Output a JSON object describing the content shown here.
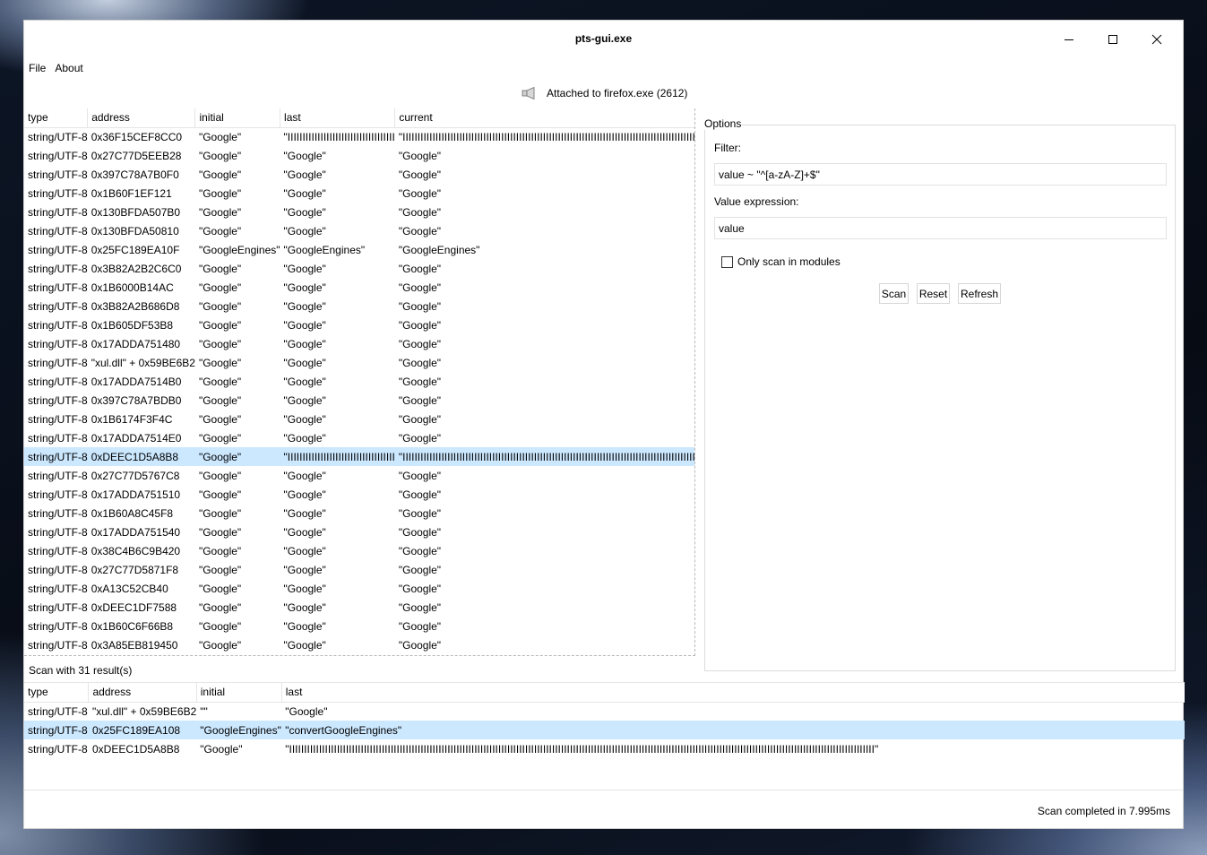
{
  "window": {
    "title": "pts-gui.exe",
    "minimize_icon": "minimize-icon",
    "maximize_icon": "maximize-icon",
    "close_icon": "close-icon"
  },
  "menu": {
    "file": "File",
    "about": "About"
  },
  "attached": {
    "icon": "speaker-icon",
    "text": "Attached to firefox.exe (2612)"
  },
  "results": {
    "columns": [
      "type",
      "address",
      "initial",
      "last",
      "current"
    ],
    "rows": [
      [
        "string/UTF-8",
        "0x36F15CEF8CC0",
        "\"Google\"",
        "\"IIIIIIIIIIIIIIIIIIIIIIIIIIIIIIIIIIII",
        "\"IIIIIIIIIIIIIIIIIIIIIIIIIIIIIIIIIIIIIIIIIIIIIIIIIIIIIIIIIIIIIIIIIIIIIIIIIIIIIIIIIIIIIIIIIIIIIIIIIII"
      ],
      [
        "string/UTF-8",
        "0x27C77D5EEB28",
        "\"Google\"",
        "\"Google\"",
        "\"Google\""
      ],
      [
        "string/UTF-8",
        "0x397C78A7B0F0",
        "\"Google\"",
        "\"Google\"",
        "\"Google\""
      ],
      [
        "string/UTF-8",
        "0x1B60F1EF121",
        "\"Google\"",
        "\"Google\"",
        "\"Google\""
      ],
      [
        "string/UTF-8",
        "0x130BFDA507B0",
        "\"Google\"",
        "\"Google\"",
        "\"Google\""
      ],
      [
        "string/UTF-8",
        "0x130BFDA50810",
        "\"Google\"",
        "\"Google\"",
        "\"Google\""
      ],
      [
        "string/UTF-8",
        "0x25FC189EA10F",
        "\"GoogleEngines\"",
        "\"GoogleEngines\"",
        "\"GoogleEngines\""
      ],
      [
        "string/UTF-8",
        "0x3B82A2B2C6C0",
        "\"Google\"",
        "\"Google\"",
        "\"Google\""
      ],
      [
        "string/UTF-8",
        "0x1B6000B14AC",
        "\"Google\"",
        "\"Google\"",
        "\"Google\""
      ],
      [
        "string/UTF-8",
        "0x3B82A2B686D8",
        "\"Google\"",
        "\"Google\"",
        "\"Google\""
      ],
      [
        "string/UTF-8",
        "0x1B605DF53B8",
        "\"Google\"",
        "\"Google\"",
        "\"Google\""
      ],
      [
        "string/UTF-8",
        "0x17ADDA751480",
        "\"Google\"",
        "\"Google\"",
        "\"Google\""
      ],
      [
        "string/UTF-8",
        "\"xul.dll\" + 0x59BE6B2",
        "\"Google\"",
        "\"Google\"",
        "\"Google\""
      ],
      [
        "string/UTF-8",
        "0x17ADDA7514B0",
        "\"Google\"",
        "\"Google\"",
        "\"Google\""
      ],
      [
        "string/UTF-8",
        "0x397C78A7BDB0",
        "\"Google\"",
        "\"Google\"",
        "\"Google\""
      ],
      [
        "string/UTF-8",
        "0x1B6174F3F4C",
        "\"Google\"",
        "\"Google\"",
        "\"Google\""
      ],
      [
        "string/UTF-8",
        "0x17ADDA7514E0",
        "\"Google\"",
        "\"Google\"",
        "\"Google\""
      ],
      [
        "string/UTF-8",
        "0xDEEC1D5A8B8",
        "\"Google\"",
        "\"IIIIIIIIIIIIIIIIIIIIIIIIIIIIIIIIIIII",
        "\"IIIIIIIIIIIIIIIIIIIIIIIIIIIIIIIIIIIIIIIIIIIIIIIIIIIIIIIIIIIIIIIIIIIIIIIIIIIIIIIIIIIIIIIIIIIIIIIIIII"
      ],
      [
        "string/UTF-8",
        "0x27C77D5767C8",
        "\"Google\"",
        "\"Google\"",
        "\"Google\""
      ],
      [
        "string/UTF-8",
        "0x17ADDA751510",
        "\"Google\"",
        "\"Google\"",
        "\"Google\""
      ],
      [
        "string/UTF-8",
        "0x1B60A8C45F8",
        "\"Google\"",
        "\"Google\"",
        "\"Google\""
      ],
      [
        "string/UTF-8",
        "0x17ADDA751540",
        "\"Google\"",
        "\"Google\"",
        "\"Google\""
      ],
      [
        "string/UTF-8",
        "0x38C4B6C9B420",
        "\"Google\"",
        "\"Google\"",
        "\"Google\""
      ],
      [
        "string/UTF-8",
        "0x27C77D5871F8",
        "\"Google\"",
        "\"Google\"",
        "\"Google\""
      ],
      [
        "string/UTF-8",
        "0xA13C52CB40",
        "\"Google\"",
        "\"Google\"",
        "\"Google\""
      ],
      [
        "string/UTF-8",
        "0xDEEC1DF7588",
        "\"Google\"",
        "\"Google\"",
        "\"Google\""
      ],
      [
        "string/UTF-8",
        "0x1B60C6F66B8",
        "\"Google\"",
        "\"Google\"",
        "\"Google\""
      ],
      [
        "string/UTF-8",
        "0x3A85EB819450",
        "\"Google\"",
        "\"Google\"",
        "\"Google\""
      ]
    ],
    "selected_row": 17,
    "count_text": "Scan with 31 result(s)"
  },
  "options": {
    "legend": "Options",
    "filter_label": "Filter:",
    "filter_value": "value ~ \"^[a-zA-Z]+$\"",
    "expr_label": "Value expression:",
    "expr_value": "value",
    "only_modules_label": "Only scan in modules",
    "only_modules_checked": false,
    "scan_button": "Scan",
    "reset_button": "Reset",
    "refresh_button": "Refresh"
  },
  "changes": {
    "columns": [
      "type",
      "address",
      "initial",
      "last"
    ],
    "rows": [
      [
        "string/UTF-8",
        "\"xul.dll\" + 0x59BE6B2",
        "\"\"",
        "\"Google\""
      ],
      [
        "string/UTF-8",
        "0x25FC189EA108",
        "\"GoogleEngines\"",
        "\"convertGoogleEngines\""
      ],
      [
        "string/UTF-8",
        "0xDEEC1D5A8B8",
        "\"Google\"",
        "\"IIIIIIIIIIIIIIIIIIIIIIIIIIIIIIIIIIIIIIIIIIIIIIIIIIIIIIIIIIIIIIIIIIIIIIIIIIIIIIIIIIIIIIIIIIIIIIIIIIIIIIIIIIIIIIIIIIIIIIIIIIIIIIIIIIIIIIIIIIIIIIIIIIIIIIIIIIIIIIIIIIIIIIIIIIIIIIIIIIIIIIIIIIIIIIIIIIII\""
      ]
    ],
    "selected_row": 1
  },
  "status": {
    "text": "Scan completed in 7.995ms"
  }
}
